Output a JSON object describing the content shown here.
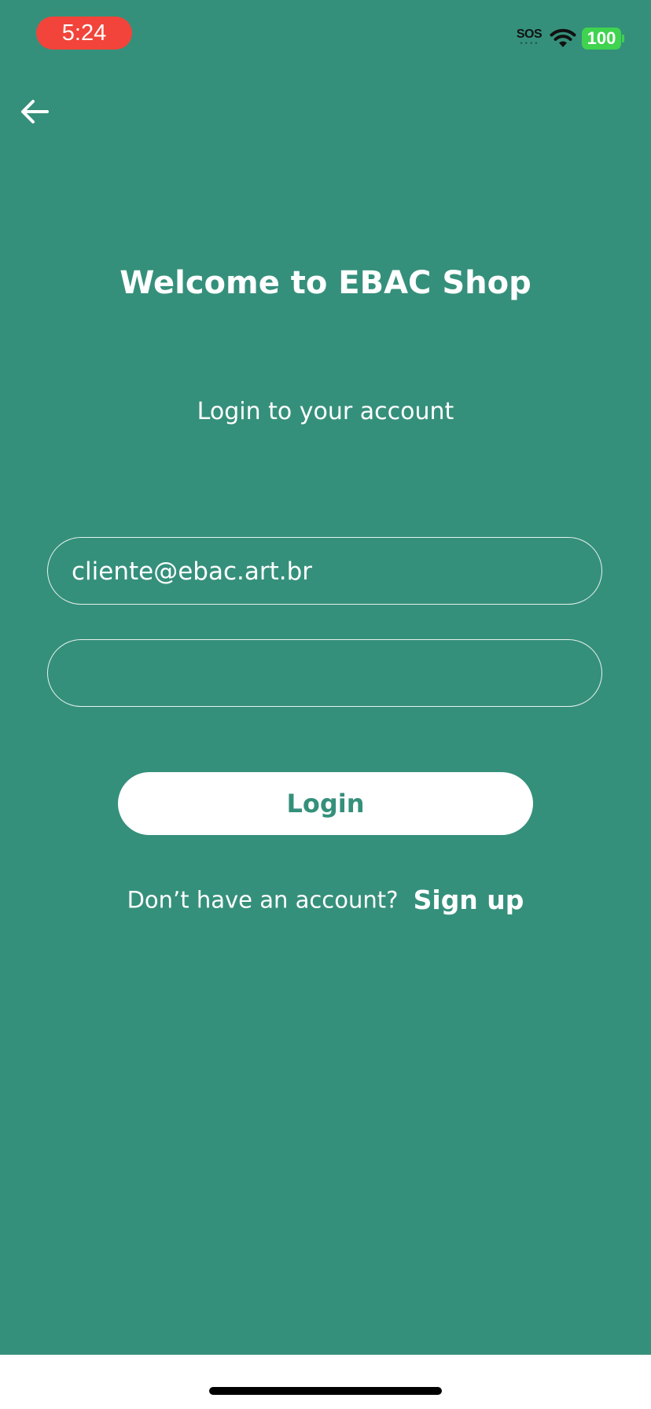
{
  "status_bar": {
    "time": "5:24",
    "sos": "SOS",
    "battery": "100"
  },
  "icons": {
    "back": "arrow-left-icon",
    "wifi": "wifi-icon"
  },
  "colors": {
    "background": "#35907b",
    "time_pill": "#f2443a",
    "battery": "#3fd34f",
    "button_bg": "#ffffff",
    "button_text": "#35907b"
  },
  "login": {
    "title": "Welcome to EBAC Shop",
    "subtitle": "Login to your account",
    "email_value": "cliente@ebac.art.br",
    "password_value": "",
    "login_button": "Login",
    "signup_prompt": "Don’t have an account?",
    "signup_link": "Sign up"
  }
}
